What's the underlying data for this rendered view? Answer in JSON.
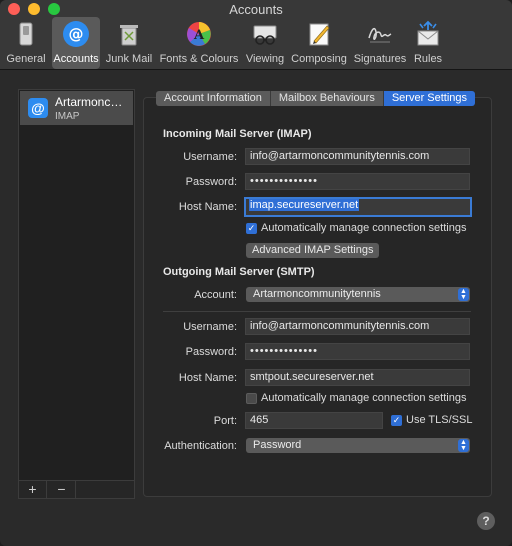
{
  "window": {
    "title": "Accounts"
  },
  "toolbar": {
    "items": [
      {
        "label": "General"
      },
      {
        "label": "Accounts"
      },
      {
        "label": "Junk Mail"
      },
      {
        "label": "Fonts & Colours"
      },
      {
        "label": "Viewing"
      },
      {
        "label": "Composing"
      },
      {
        "label": "Signatures"
      },
      {
        "label": "Rules"
      }
    ],
    "active": "Accounts"
  },
  "sidebar": {
    "account": {
      "name": "Artarmoncommunitytennis",
      "display_name": "Artarmonc…",
      "type": "IMAP"
    },
    "add_label": "+",
    "remove_label": "−"
  },
  "tabs": [
    "Account Information",
    "Mailbox Behaviours",
    "Server Settings"
  ],
  "active_tab": "Server Settings",
  "incoming": {
    "title": "Incoming Mail Server (IMAP)",
    "username_label": "Username:",
    "username": "info@artarmoncommunitytennis.com",
    "password_label": "Password:",
    "password": "••••••••••••••",
    "host_label": "Host Name:",
    "host": "imap.secureserver.net",
    "auto_manage_label": "Automatically manage connection settings",
    "auto_manage_checked": true,
    "advanced_button": "Advanced IMAP Settings"
  },
  "outgoing": {
    "title": "Outgoing Mail Server (SMTP)",
    "account_label": "Account:",
    "account": "Artarmoncommunitytennis",
    "username_label": "Username:",
    "username": "info@artarmoncommunitytennis.com",
    "password_label": "Password:",
    "password": "••••••••••••••",
    "host_label": "Host Name:",
    "host": "smtpout.secureserver.net",
    "auto_manage_label": "Automatically manage connection settings",
    "auto_manage_checked": false,
    "port_label": "Port:",
    "port": "465",
    "tls_label": "Use TLS/SSL",
    "tls_checked": true,
    "auth_label": "Authentication:",
    "auth": "Password"
  },
  "help_label": "?",
  "colors": {
    "accent": "#2f6fd6",
    "panel": "#262626",
    "field": "#3a3a3a"
  }
}
